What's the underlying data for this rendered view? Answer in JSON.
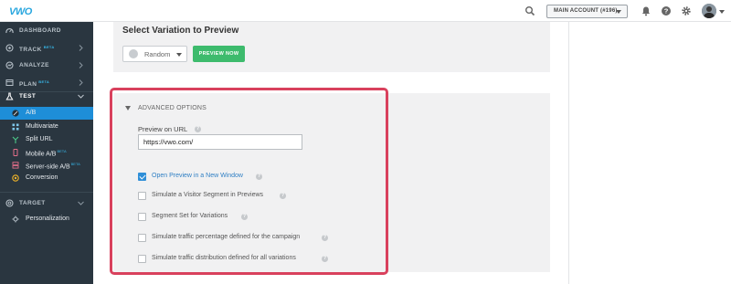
{
  "header": {
    "logo_text": "VWO",
    "account_label": "MAIN ACCOUNT (#196)"
  },
  "sidebar": {
    "items": [
      {
        "label": "DASHBOARD",
        "beta": ""
      },
      {
        "label": "TRACK",
        "beta": "BETA"
      },
      {
        "label": "ANALYZE",
        "beta": ""
      },
      {
        "label": "PLAN",
        "beta": "BETA"
      },
      {
        "label": "TEST",
        "beta": ""
      },
      {
        "label": "TARGET",
        "beta": ""
      }
    ],
    "test_sub": [
      {
        "label": "A/B",
        "beta": ""
      },
      {
        "label": "Multivariate",
        "beta": ""
      },
      {
        "label": "Split URL",
        "beta": ""
      },
      {
        "label": "Mobile A/B",
        "beta": "BETA"
      },
      {
        "label": "Server-side A/B",
        "beta": "BETA"
      },
      {
        "label": "Conversion",
        "beta": ""
      }
    ],
    "target_sub": [
      {
        "label": "Personalization",
        "beta": ""
      }
    ]
  },
  "preview": {
    "title": "Select Variation to Preview",
    "variation_value": "Random",
    "preview_button": "PREVIEW NOW"
  },
  "advanced": {
    "title": "ADVANCED OPTIONS",
    "url_label": "Preview on URL",
    "url_value": "https://vwo.com/",
    "help_glyph": "?",
    "options": [
      {
        "label": "Open Preview in a New Window",
        "checked": true
      },
      {
        "label": "Simulate a Visitor Segment in Previews",
        "checked": false
      },
      {
        "label": "Segment Set for Variations",
        "checked": false
      },
      {
        "label": "Simulate traffic percentage defined for the campaign",
        "checked": false
      },
      {
        "label": "Simulate traffic distribution defined for all variations",
        "checked": false
      }
    ]
  },
  "colors": {
    "sidebar_bg": "#2a3640",
    "active_item": "#1e8ed8",
    "primary_button": "#3dbb6d",
    "highlight_border": "#d9415d",
    "checkbox_checked": "#2f8fd8"
  }
}
